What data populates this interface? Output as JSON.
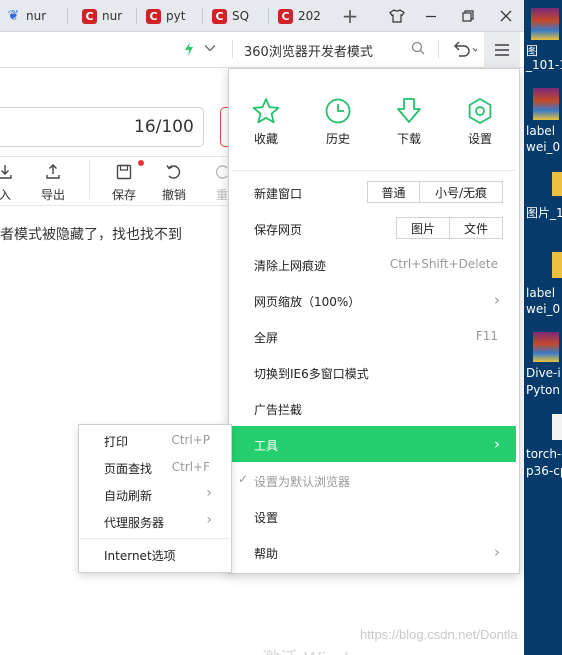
{
  "tabs": [
    {
      "icon": "baidu-paw-icon",
      "label": "nur"
    },
    {
      "icon": "csdn-icon",
      "label": "nur"
    },
    {
      "icon": "csdn-icon",
      "label": "pyt"
    },
    {
      "icon": "csdn-icon",
      "label": "SQ"
    },
    {
      "icon": "csdn-icon",
      "label": "202"
    }
  ],
  "address": {
    "mode_text": "360浏览器开发者模式"
  },
  "page": {
    "counter": "16/100",
    "toolbar": [
      {
        "icon": "import-icon",
        "label": "入"
      },
      {
        "icon": "export-icon",
        "label": "导出"
      },
      {
        "icon": "save-icon",
        "label": "保存"
      },
      {
        "icon": "undo-icon",
        "label": "撤销"
      },
      {
        "icon": "redo-icon",
        "label": "重"
      }
    ],
    "text": "者模式被隐藏了，找也找不到",
    "watermark": "https://blog.csdn.net/Dontla",
    "activate": "激活 Wind"
  },
  "desktop": {
    "labels": [
      "图",
      "_101-1",
      "label",
      "wei_0",
      "图片_1",
      "label",
      "wei_0",
      "Dive-i",
      "Pyton",
      "torch-",
      "p36-cp"
    ]
  },
  "menu": {
    "quick": [
      {
        "icon": "star-icon",
        "label": "收藏"
      },
      {
        "icon": "clock-icon",
        "label": "历史"
      },
      {
        "icon": "download-icon",
        "label": "下载"
      },
      {
        "icon": "gear-icon",
        "label": "设置"
      }
    ],
    "new_window": {
      "label": "新建窗口",
      "btn1": "普通",
      "btn2": "小号/无痕"
    },
    "save_page": {
      "label": "保存网页",
      "btn1": "图片",
      "btn2": "文件"
    },
    "clear_traces": {
      "label": "清除上网痕迹",
      "shortcut": "Ctrl+Shift+Delete"
    },
    "zoom": {
      "label": "网页缩放（100%）"
    },
    "fullscreen": {
      "label": "全屏",
      "shortcut": "F11"
    },
    "ie6": {
      "label": "切换到IE6多窗口模式"
    },
    "adblock": {
      "label": "广告拦截"
    },
    "tools": {
      "label": "工具"
    },
    "default_browser": {
      "label": "设置为默认浏览器"
    },
    "settings": {
      "label": "设置"
    },
    "help": {
      "label": "帮助"
    }
  },
  "submenu": {
    "print": {
      "label": "打印",
      "shortcut": "Ctrl+P"
    },
    "find": {
      "label": "页面查找",
      "shortcut": "Ctrl+F"
    },
    "auto_refresh": {
      "label": "自动刷新"
    },
    "proxy": {
      "label": "代理服务器"
    },
    "internet_options": {
      "label": "Internet选项"
    }
  },
  "colors": {
    "accent": "#26cf6e",
    "csdn_red": "#d3222a",
    "desktop": "#063b6c"
  }
}
